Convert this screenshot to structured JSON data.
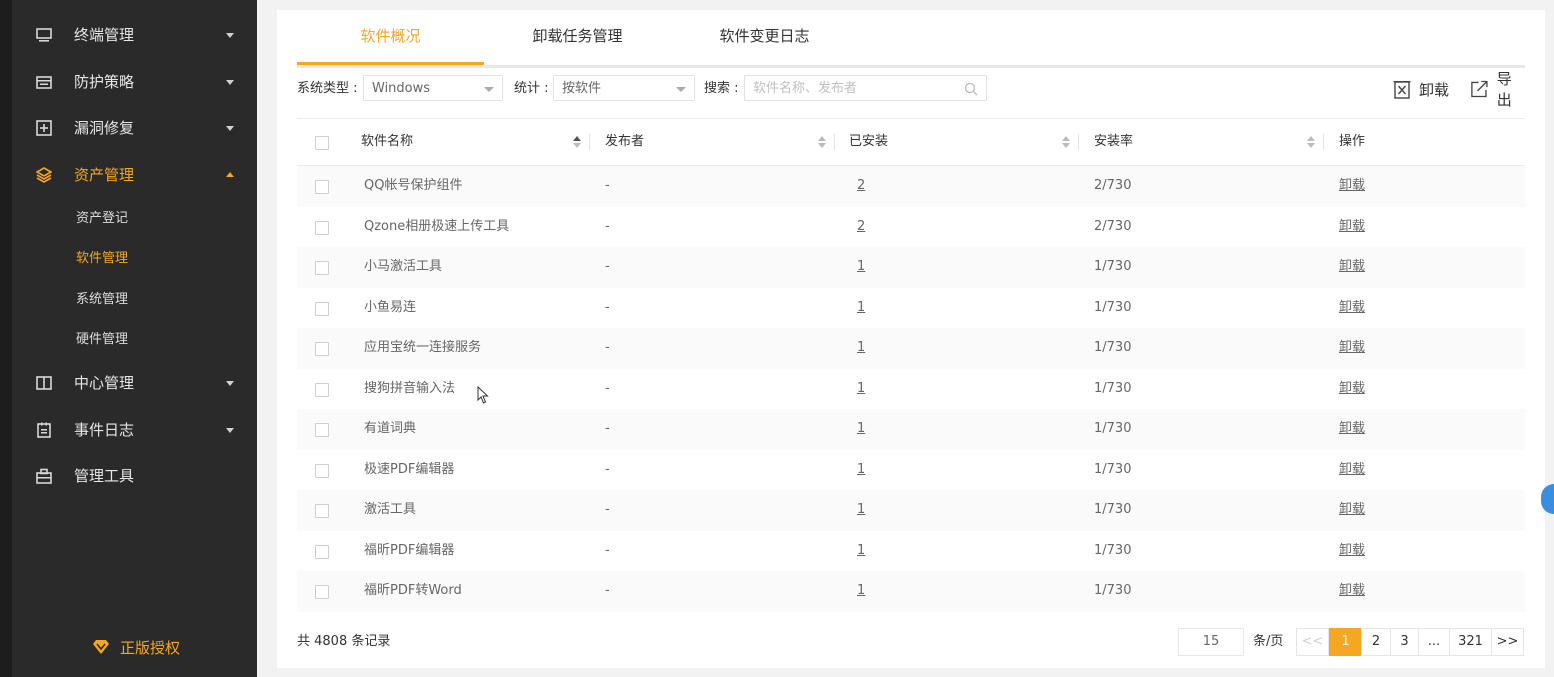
{
  "sidebar": {
    "items": [
      {
        "label": "终端管理",
        "icon": "monitor-icon"
      },
      {
        "label": "防护策略",
        "icon": "shield-policy-icon"
      },
      {
        "label": "漏洞修复",
        "icon": "plus-box-icon"
      },
      {
        "label": "资产管理",
        "icon": "layers-icon"
      },
      {
        "label": "中心管理",
        "icon": "book-icon"
      },
      {
        "label": "事件日志",
        "icon": "calendar-icon"
      },
      {
        "label": "管理工具",
        "icon": "toolbox-icon"
      }
    ],
    "subitems": [
      "资产登记",
      "软件管理",
      "系统管理",
      "硬件管理"
    ],
    "license_label": "正版授权"
  },
  "tabs": [
    "软件概况",
    "卸载任务管理",
    "软件变更日志"
  ],
  "filters": {
    "system_type_label": "系统类型 :",
    "system_type_value": "Windows",
    "stat_label": "统计 :",
    "stat_value": "按软件",
    "search_label": "搜索 :",
    "search_placeholder": "软件名称、发布者"
  },
  "toolbar": {
    "uninstall_label": "卸载",
    "export_label": "导出"
  },
  "table": {
    "headers": [
      "软件名称",
      "发布者",
      "已安装",
      "安装率",
      "操作"
    ],
    "rows": [
      {
        "name": "QQ帐号保护组件",
        "publisher": "-",
        "installed": "2",
        "rate": "2/730",
        "action": "卸载"
      },
      {
        "name": "Qzone相册极速上传工具",
        "publisher": "-",
        "installed": "2",
        "rate": "2/730",
        "action": "卸载"
      },
      {
        "name": "小马激活工具",
        "publisher": "-",
        "installed": "1",
        "rate": "1/730",
        "action": "卸载"
      },
      {
        "name": "小鱼易连",
        "publisher": "-",
        "installed": "1",
        "rate": "1/730",
        "action": "卸载"
      },
      {
        "name": "应用宝统一连接服务",
        "publisher": "-",
        "installed": "1",
        "rate": "1/730",
        "action": "卸载"
      },
      {
        "name": "搜狗拼音输入法",
        "publisher": "-",
        "installed": "1",
        "rate": "1/730",
        "action": "卸载"
      },
      {
        "name": "有道词典",
        "publisher": "-",
        "installed": "1",
        "rate": "1/730",
        "action": "卸载"
      },
      {
        "name": "极速PDF编辑器",
        "publisher": "-",
        "installed": "1",
        "rate": "1/730",
        "action": "卸载"
      },
      {
        "name": "激活工具",
        "publisher": "-",
        "installed": "1",
        "rate": "1/730",
        "action": "卸载"
      },
      {
        "name": "福昕PDF编辑器",
        "publisher": "-",
        "installed": "1",
        "rate": "1/730",
        "action": "卸载"
      },
      {
        "name": "福昕PDF转Word",
        "publisher": "-",
        "installed": "1",
        "rate": "1/730",
        "action": "卸载"
      }
    ]
  },
  "footer": {
    "total": "共 4808 条记录",
    "page_size": "15",
    "per_page_label": "条/页",
    "pages": [
      "1",
      "2",
      "3",
      "...",
      "321",
      ">>"
    ],
    "prev": "<<"
  },
  "colors": {
    "accent": "#f5a623",
    "sidebar_bg": "#2a2a2a"
  }
}
